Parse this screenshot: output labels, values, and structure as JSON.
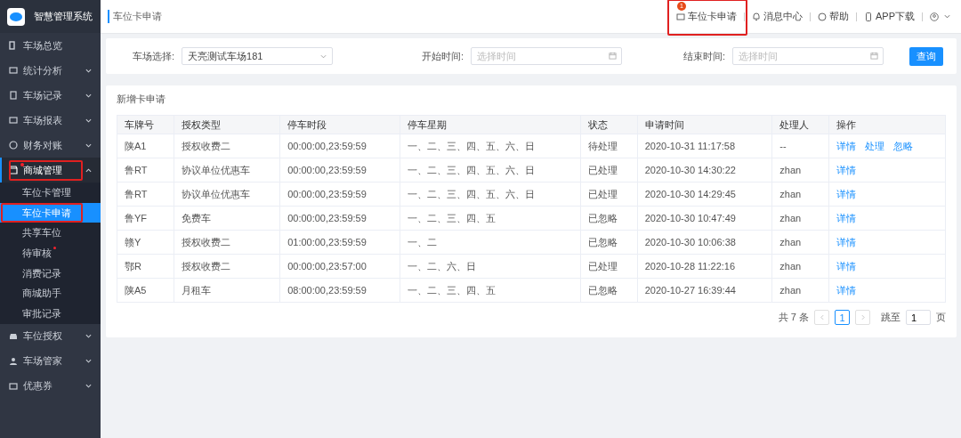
{
  "app": {
    "title": "智慧管理系统"
  },
  "sidebar": {
    "items": [
      {
        "label": "车场总览",
        "has_children": false,
        "expanded": false,
        "highlighted": false
      },
      {
        "label": "统计分析",
        "has_children": true,
        "expanded": false,
        "highlighted": false
      },
      {
        "label": "车场记录",
        "has_children": true,
        "expanded": false,
        "highlighted": false
      },
      {
        "label": "车场报表",
        "has_children": true,
        "expanded": false,
        "highlighted": false
      },
      {
        "label": "财务对账",
        "has_children": true,
        "expanded": false,
        "highlighted": false
      },
      {
        "label": "商城管理",
        "has_children": true,
        "expanded": true,
        "highlighted": true,
        "dot": true,
        "children": [
          {
            "label": "车位卡管理",
            "selected": false,
            "dot": false,
            "highlighted": false
          },
          {
            "label": "车位卡申请",
            "selected": true,
            "dot": false,
            "highlighted": true
          },
          {
            "label": "共享车位",
            "selected": false,
            "dot": false,
            "highlighted": false
          },
          {
            "label": "待审核",
            "selected": false,
            "dot": true,
            "highlighted": false
          },
          {
            "label": "消费记录",
            "selected": false,
            "dot": false,
            "highlighted": false
          },
          {
            "label": "商城助手",
            "selected": false,
            "dot": false,
            "highlighted": false
          },
          {
            "label": "审批记录",
            "selected": false,
            "dot": false,
            "highlighted": false
          }
        ]
      },
      {
        "label": "车位授权",
        "has_children": true,
        "expanded": false,
        "highlighted": false
      },
      {
        "label": "车场管家",
        "has_children": true,
        "expanded": false,
        "highlighted": false
      },
      {
        "label": "优惠券",
        "has_children": true,
        "expanded": false,
        "highlighted": false
      }
    ]
  },
  "breadcrumb": "车位卡申请",
  "header_actions": [
    {
      "label": "车位卡申请",
      "badge": "1",
      "highlighted": true
    },
    {
      "label": "消息中心",
      "highlighted": false
    },
    {
      "label": "帮助",
      "highlighted": false
    },
    {
      "label": "APP下载",
      "highlighted": false
    }
  ],
  "filters": [
    {
      "label": "车场选择:",
      "kind": "select",
      "value": "天亮测试车场181"
    },
    {
      "label": "开始时间:",
      "kind": "date",
      "placeholder": "选择时间"
    },
    {
      "label": "结束时间:",
      "kind": "date",
      "placeholder": "选择时间"
    }
  ],
  "query_button": "查询",
  "section_title": "新增卡申请",
  "table": {
    "columns": [
      "车牌号",
      "授权类型",
      "停车时段",
      "停车星期",
      "状态",
      "申请时间",
      "处理人",
      "操作"
    ],
    "rows": [
      {
        "cells": [
          "陕A1",
          "授权收费二",
          "00:00:00,23:59:59",
          "一、二、三、四、五、六、日",
          "待处理",
          "2020-10-31 11:17:58",
          "--"
        ],
        "actions": [
          "详情",
          "处理",
          "忽略"
        ]
      },
      {
        "cells": [
          "鲁RT",
          "协议单位优惠车",
          "00:00:00,23:59:59",
          "一、二、三、四、五、六、日",
          "已处理",
          "2020-10-30 14:30:22",
          "zhan"
        ],
        "actions": [
          "详情"
        ]
      },
      {
        "cells": [
          "鲁RT",
          "协议单位优惠车",
          "00:00:00,23:59:59",
          "一、二、三、四、五、六、日",
          "已处理",
          "2020-10-30 14:29:45",
          "zhan"
        ],
        "actions": [
          "详情"
        ]
      },
      {
        "cells": [
          "鲁YF",
          "免费车",
          "00:00:00,23:59:59",
          "一、二、三、四、五",
          "已忽略",
          "2020-10-30 10:47:49",
          "zhan"
        ],
        "actions": [
          "详情"
        ]
      },
      {
        "cells": [
          "赣Y",
          "授权收费二",
          "01:00:00,23:59:59",
          "一、二",
          "已忽略",
          "2020-10-30 10:06:38",
          "zhan"
        ],
        "actions": [
          "详情"
        ]
      },
      {
        "cells": [
          "鄂R",
          "授权收费二",
          "00:00:00,23:57:00",
          "一、二、六、日",
          "已处理",
          "2020-10-28 11:22:16",
          "zhan"
        ],
        "actions": [
          "详情"
        ]
      },
      {
        "cells": [
          "陕A5",
          "月租车",
          "08:00:00,23:59:59",
          "一、二、三、四、五",
          "已忽略",
          "2020-10-27 16:39:44",
          "zhan"
        ],
        "actions": [
          "详情"
        ]
      }
    ]
  },
  "pagination": {
    "total": "共 7 条",
    "pages": [
      {
        "label": "1",
        "selected": true
      }
    ],
    "jump_label": "跳至",
    "jump_value": "1",
    "page_suffix": "页"
  }
}
